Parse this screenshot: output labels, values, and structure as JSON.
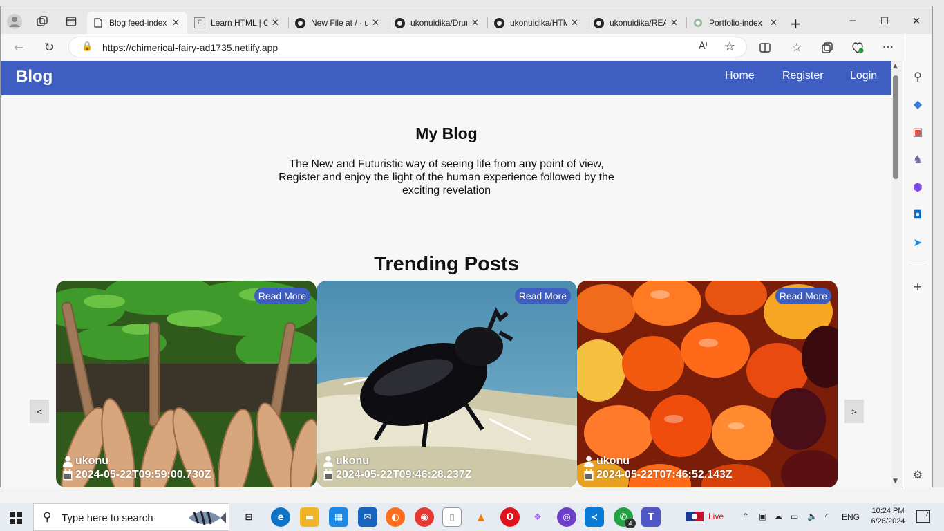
{
  "browser": {
    "tabs": [
      {
        "label": "Blog feed-index",
        "active": true,
        "favicon": "page-icon"
      },
      {
        "label": "Learn HTML | Codecademy",
        "active": false,
        "favicon": "codecademy-icon"
      },
      {
        "label": "New File at / · ukonuidika",
        "active": false,
        "favicon": "github-icon"
      },
      {
        "label": "ukonuidika/Drum-kit",
        "active": false,
        "favicon": "github-icon"
      },
      {
        "label": "ukonuidika/HTML",
        "active": false,
        "favicon": "github-icon"
      },
      {
        "label": "ukonuidika/README",
        "active": false,
        "favicon": "github-icon"
      },
      {
        "label": "Portfolio-index",
        "active": false,
        "favicon": "portfolio-icon"
      }
    ],
    "url": "https://chimerical-fairy-ad1735.netlify.app"
  },
  "site": {
    "brand": "Blog",
    "nav": {
      "home": "Home",
      "register": "Register",
      "login": "Login"
    },
    "hero": {
      "title": "My Blog",
      "description": "The New and Futuristic way of seeing life from any point of view, Register and enjoy the light of the human experience followed by the exciting revelation"
    },
    "trending": {
      "title": "Trending Posts",
      "prev": "<",
      "next": ">",
      "posts": [
        {
          "read_more": "Read More",
          "author": "ukonu",
          "date": "2024-05-22T09:59:00.730Z",
          "image": "cassava-roots"
        },
        {
          "read_more": "Read More",
          "author": "ukonu",
          "date": "2024-05-22T09:46:28.237Z",
          "image": "rhinoceros-beetle"
        },
        {
          "read_more": "Read More",
          "author": "ukonu",
          "date": "2024-05-22T07:46:52.143Z",
          "image": "palm-fruits"
        }
      ]
    }
  },
  "taskbar": {
    "search_placeholder": "Type here to search",
    "live_label": "Live",
    "language": "ENG",
    "time": "10:24 PM",
    "date": "6/26/2024",
    "notification_count": "7",
    "whatsapp_badge": "4"
  },
  "colors": {
    "brand_blue": "#3f5ec2"
  }
}
